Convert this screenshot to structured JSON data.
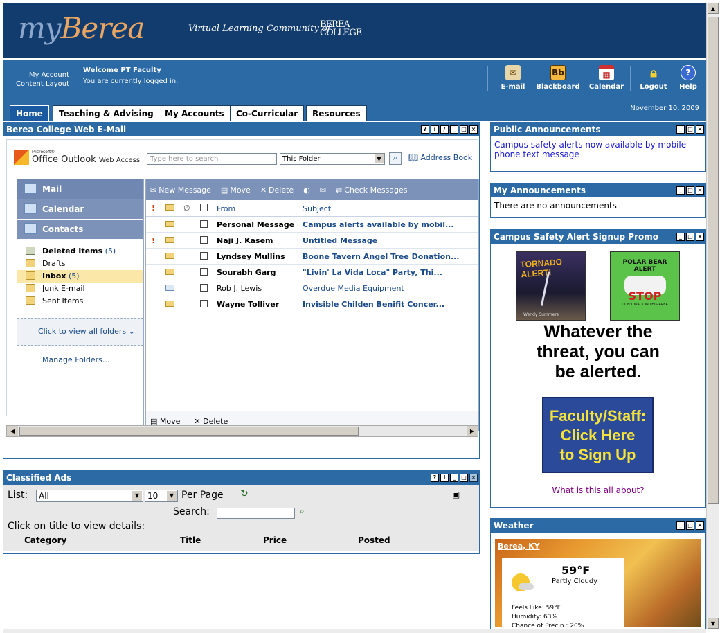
{
  "banner": {
    "logo_my": "my",
    "logo_berea": "Berea",
    "tagline": "Virtual Learning Community of",
    "college_line1": "BEREA",
    "college_line2": "COLLEGE"
  },
  "header": {
    "account_links": [
      "My Account",
      "Content Layout"
    ],
    "welcome": "Welcome PT Faculty",
    "logged_in": "You are currently logged in.",
    "date": "November 10, 2009"
  },
  "toolbar": {
    "email": "E-mail",
    "blackboard": "Blackboard",
    "blackboard_icon_text": "Bb",
    "calendar": "Calendar",
    "logout": "Logout",
    "help": "Help"
  },
  "tabs": [
    "Home",
    "Teaching & Advising",
    "My Accounts",
    "Co-Curricular",
    "Resources"
  ],
  "webmail": {
    "title": "Berea College Web E-Mail",
    "logo_small": "Microsoft®",
    "logo_text": "Office Outlook",
    "logo_sub": "Web Access",
    "search_placeholder": "Type here to search",
    "folder_select": "This Folder",
    "address_book": "Address Book",
    "nav": [
      "Mail",
      "Calendar",
      "Contacts"
    ],
    "folders": [
      {
        "name": "Deleted Items",
        "count": "(5)",
        "bold": true
      },
      {
        "name": "Drafts",
        "count": ""
      },
      {
        "name": "Inbox",
        "count": "(5)",
        "bold": true
      },
      {
        "name": "Junk E-mail",
        "count": ""
      },
      {
        "name": "Sent Items",
        "count": ""
      }
    ],
    "view_all": "Click to view all folders",
    "manage": "Manage Folders...",
    "actions": {
      "new_message": "New Message",
      "move": "Move",
      "delete": "Delete",
      "check": "Check Messages"
    },
    "columns": {
      "from": "From",
      "subject": "Subject"
    },
    "messages": [
      {
        "from": "Personal Message",
        "subject": "Campus alerts available by mobil...",
        "unread": true,
        "important": false
      },
      {
        "from": "Naji J. Kasem",
        "subject": "Untitled Message",
        "unread": true,
        "important": true
      },
      {
        "from": "Lyndsey Mullins",
        "subject": "Boone Tavern Angel Tree Donation...",
        "unread": true,
        "important": false
      },
      {
        "from": "Sourabh Garg",
        "subject": "\"Livin' La Vida Loca\" Party, Thi...",
        "unread": true,
        "important": false
      },
      {
        "from": "Rob J. Lewis",
        "subject": "Overdue Media Equipment",
        "unread": false,
        "important": false
      },
      {
        "from": "Wayne Tolliver",
        "subject": "Invisible Childen Benifit Concer...",
        "unread": true,
        "important": false
      }
    ],
    "bottom_move": "Move",
    "bottom_delete": "Delete"
  },
  "classified": {
    "title": "Classified Ads",
    "list_label": "List:",
    "list_value": "All",
    "per_page_value": "10",
    "per_page_label": "Per Page",
    "search_label": "Search:",
    "hint": "Click on title to view details:",
    "columns": [
      "Category",
      "Title",
      "Price",
      "Posted"
    ]
  },
  "public_ann": {
    "title": "Public Announcements",
    "text": "Campus safety alerts now available by mobile phone text message"
  },
  "my_ann": {
    "title": "My Announcements",
    "text": "There are no announcements"
  },
  "promo": {
    "title": "Campus Safety Alert Signup Promo",
    "book1": "TORNADO ALERT!",
    "book1_author": "Wendy Summers",
    "book2_line1": "POLAR BEAR",
    "book2_line2": "ALERT",
    "book2_stop": "STOP",
    "book2_sub": "DON'T WALK IN THIS AREA",
    "headline": [
      "Whatever the",
      "threat, you can",
      "be alerted."
    ],
    "button": [
      "Faculty/Staff:",
      "Click Here",
      "to Sign Up"
    ],
    "link": "What is this all about?"
  },
  "weather": {
    "title": "Weather",
    "location": "Berea, KY",
    "temp": "59°F",
    "cond": "Partly Cloudy",
    "feels": "Feels Like: 59°F",
    "humidity": "Humidity: 63%",
    "precip": "Chance of Precip.: 20%"
  },
  "colors": {
    "banner": "#123c6e",
    "navbar": "#2c6aa5",
    "portlet_header": "#2c6aa5",
    "promo_button": "#2b4a9a",
    "promo_button_text": "#f5e23a"
  }
}
